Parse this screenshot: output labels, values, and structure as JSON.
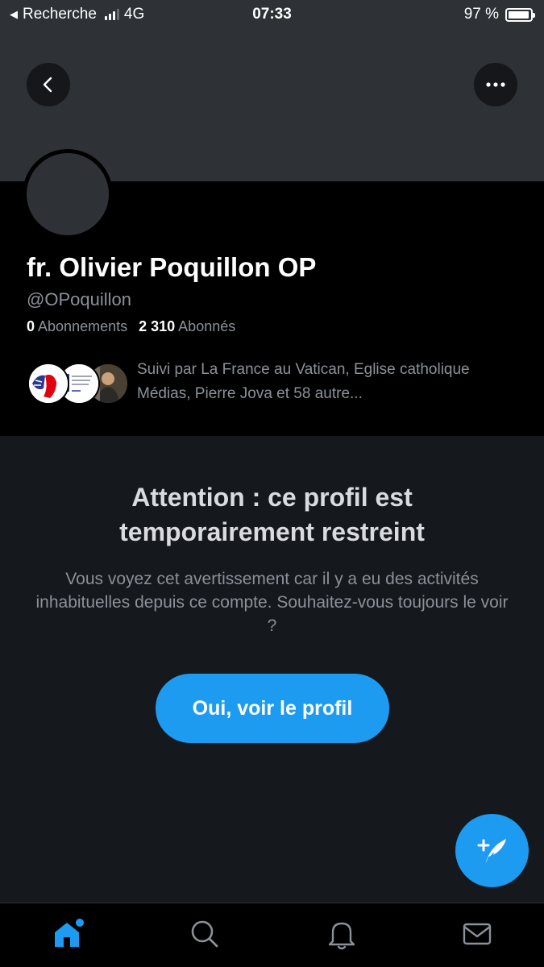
{
  "status_bar": {
    "back_app": "Recherche",
    "network": "4G",
    "time": "07:33",
    "battery": "97 %",
    "battery_level": 0.97
  },
  "profile": {
    "display_name": "fr. Olivier Poquillon OP",
    "handle": "@OPoquillon",
    "following_count": "0",
    "following_label": "Abonnements",
    "followers_count": "2 310",
    "followers_label": "Abonnés",
    "followed_by": "Suivi par La France au Vatican, Eglise catholique Médias, Pierre Jova et 58 autre..."
  },
  "warning": {
    "title": "Attention : ce profil est temporairement restreint",
    "body": "Vous voyez cet avertissement car il y a eu des activités inhabituelles depuis ce compte. Souhaitez-vous toujours le voir ?",
    "button_label": "Oui, voir le profil"
  },
  "colors": {
    "accent": "#1d9bf0",
    "background": "#15181d",
    "header_background": "#000000",
    "banner": "#2e3136",
    "secondary_text": "#8b9199"
  },
  "icons": {
    "back": "chevron-left-icon",
    "more": "more-horizontal-icon",
    "compose": "compose-tweet-icon",
    "tabs": [
      "home-icon",
      "search-icon",
      "notifications-icon",
      "messages-icon"
    ]
  }
}
